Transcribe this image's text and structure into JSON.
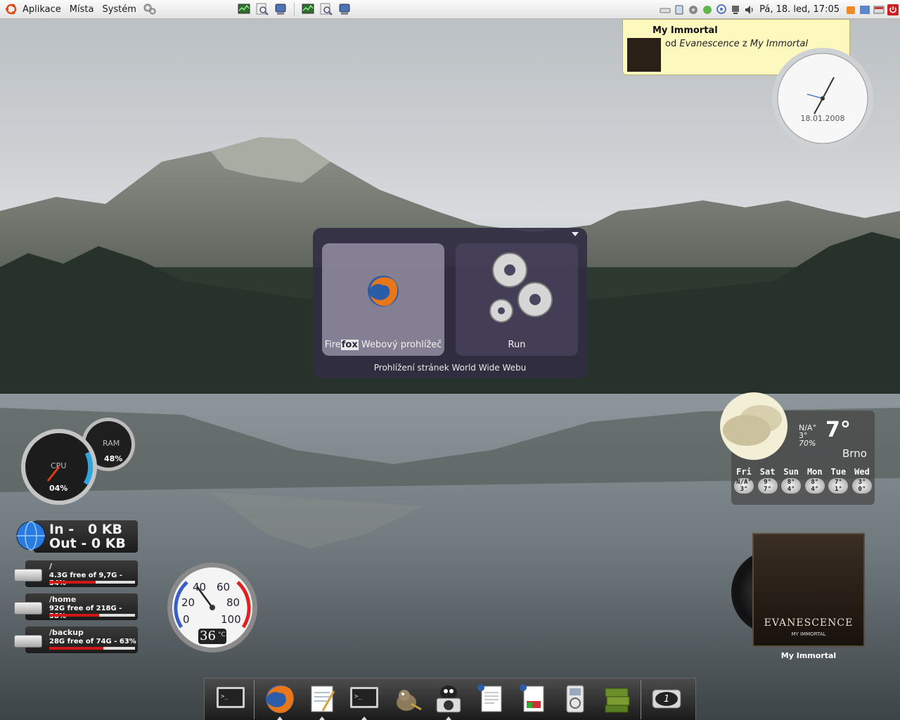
{
  "top_panel": {
    "menus": [
      "Aplikace",
      "Místa",
      "Systém"
    ],
    "clock": "Pá, 18. led, 17:05"
  },
  "notification": {
    "title": "My Immortal",
    "by": "od",
    "artist": "Evanescence",
    "from": "z",
    "album": "My Immortal"
  },
  "desk_clock": {
    "date": "18.01.2008"
  },
  "launcher": {
    "firefox_pre": "Fire",
    "firefox_match": "fox",
    "firefox_post": " Webový prohlížeč",
    "run": "Run",
    "description": "Prohlížení stránek World Wide Webu"
  },
  "system_monitor": {
    "cpu_label": "CPU",
    "cpu_value": "04%",
    "ram_label": "RAM",
    "ram_value": "48%"
  },
  "network": {
    "in": "In -   0 KB",
    "out": "Out - 0 KB"
  },
  "disks": [
    {
      "mount": "/",
      "info": "4.3G free of 9,7G - 54%",
      "used": 54
    },
    {
      "mount": "/home",
      "info": "92G free of 218G - 58%",
      "used": 58
    },
    {
      "mount": "/backup",
      "info": "28G free of 74G - 63%",
      "used": 63
    }
  ],
  "thermometer": {
    "ticks": [
      "0",
      "20",
      "40",
      "60",
      "80",
      "100"
    ],
    "value": "36",
    "unit": "°C"
  },
  "weather": {
    "na": "N/A°",
    "temp": "7°",
    "low": "3°",
    "humidity": "70%",
    "city": "Brno",
    "forecast": [
      {
        "day": "Fri",
        "high": "N/A°",
        "low": "3°"
      },
      {
        "day": "Sat",
        "high": "9°",
        "low": "7°"
      },
      {
        "day": "Sun",
        "high": "8°",
        "low": "4°"
      },
      {
        "day": "Mon",
        "high": "8°",
        "low": "4°"
      },
      {
        "day": "Tue",
        "high": "7°",
        "low": "1°"
      },
      {
        "day": "Wed",
        "high": "3°",
        "low": "0°"
      }
    ]
  },
  "album_widget": {
    "brand": "EVANESCENCE",
    "subtitle": "MY IMMORTAL",
    "caption": "My Immortal"
  },
  "dock": {
    "workspace": "1"
  },
  "colors": {
    "launcher_bg": "#322c44",
    "notification_bg": "#fdf8be",
    "disk_bar": "#d01818"
  }
}
